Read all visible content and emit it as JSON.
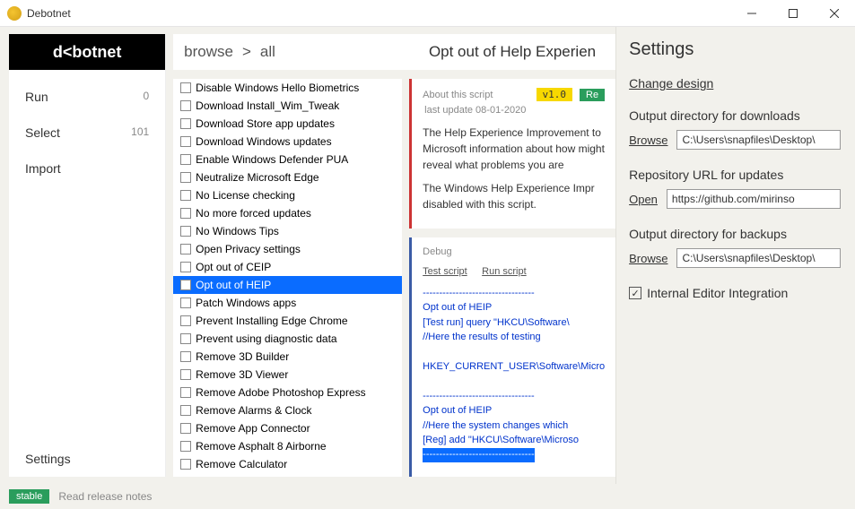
{
  "titlebar": {
    "title": "Debotnet"
  },
  "logo": "d<botnet",
  "sidebar": {
    "run": {
      "label": "Run",
      "count": "0"
    },
    "select": {
      "label": "Select",
      "count": "101"
    },
    "import": {
      "label": "Import"
    },
    "settings": {
      "label": "Settings"
    }
  },
  "breadcrumb": {
    "browse": "browse",
    "sep": ">",
    "all": "all",
    "title": "Opt out of Help Experien"
  },
  "scripts": [
    "Disable Windows Hello Biometrics",
    "Download Install_Wim_Tweak",
    "Download Store app updates",
    "Download Windows updates",
    "Enable Windows Defender PUA",
    "Neutralize Microsoft Edge",
    "No License checking",
    "No more forced updates",
    "No Windows Tips",
    "Open Privacy settings",
    "Opt out of CEIP",
    "Opt out of HEIP",
    "Patch Windows apps",
    "Prevent Installing Edge Chrome",
    "Prevent using diagnostic data",
    "Remove 3D Builder",
    "Remove 3D Viewer",
    "Remove Adobe Photoshop Express",
    "Remove Alarms & Clock",
    "Remove App Connector",
    "Remove Asphalt 8 Airborne",
    "Remove Calculator"
  ],
  "selected_index": 11,
  "about": {
    "label": "About this script",
    "version": "v1.0",
    "re": "Re",
    "last_update": "last update 08-01-2020",
    "para1": "The Help Experience Improvement to Microsoft information about how might reveal what problems you are",
    "para2": "The Windows Help Experience Impr disabled with this script."
  },
  "debug": {
    "label": "Debug",
    "test_link": "Test script",
    "run_link": "Run script",
    "output": "----------------------------------\nOpt out of HEIP\n[Test run] query \"HKCU\\Software\\\n//Here the results of testing\n\nHKEY_CURRENT_USER\\Software\\Micro\n\n----------------------------------\nOpt out of HEIP\n//Here the system changes which \n[Reg] add \"HKCU\\Software\\Microso",
    "sel": "----------------------------------"
  },
  "settings": {
    "title": "Settings",
    "change_design": "Change design",
    "out_downloads": {
      "label": "Output directory for downloads",
      "link": "Browse",
      "value": "C:\\Users\\snapfiles\\Desktop\\"
    },
    "repo": {
      "label": "Repository URL for updates",
      "link": "Open",
      "value": "https://github.com/mirinso"
    },
    "out_backups": {
      "label": "Output directory for backups",
      "link": "Browse",
      "value": "C:\\Users\\snapfiles\\Desktop\\"
    },
    "editor": {
      "label": "Internal Editor Integration",
      "checked": true
    }
  },
  "status": {
    "badge": "stable",
    "link": "Read release notes"
  }
}
